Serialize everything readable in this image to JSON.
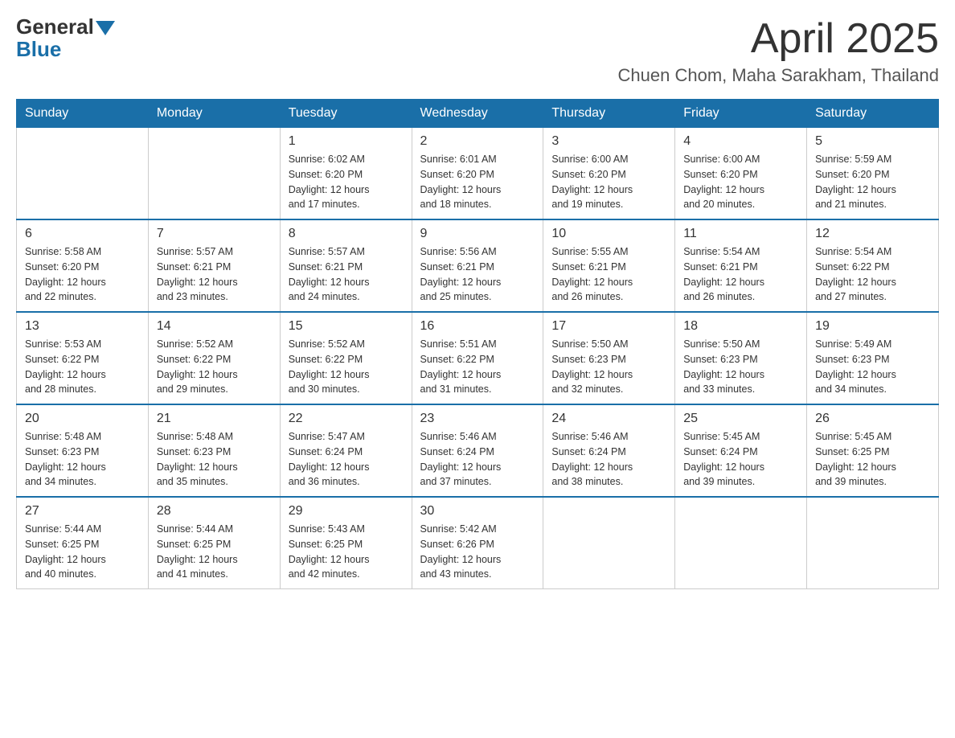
{
  "logo": {
    "general": "General",
    "blue": "Blue"
  },
  "header": {
    "month_year": "April 2025",
    "location": "Chuen Chom, Maha Sarakham, Thailand"
  },
  "weekdays": [
    "Sunday",
    "Monday",
    "Tuesday",
    "Wednesday",
    "Thursday",
    "Friday",
    "Saturday"
  ],
  "weeks": [
    [
      {
        "day": "",
        "info": ""
      },
      {
        "day": "",
        "info": ""
      },
      {
        "day": "1",
        "info": "Sunrise: 6:02 AM\nSunset: 6:20 PM\nDaylight: 12 hours\nand 17 minutes."
      },
      {
        "day": "2",
        "info": "Sunrise: 6:01 AM\nSunset: 6:20 PM\nDaylight: 12 hours\nand 18 minutes."
      },
      {
        "day": "3",
        "info": "Sunrise: 6:00 AM\nSunset: 6:20 PM\nDaylight: 12 hours\nand 19 minutes."
      },
      {
        "day": "4",
        "info": "Sunrise: 6:00 AM\nSunset: 6:20 PM\nDaylight: 12 hours\nand 20 minutes."
      },
      {
        "day": "5",
        "info": "Sunrise: 5:59 AM\nSunset: 6:20 PM\nDaylight: 12 hours\nand 21 minutes."
      }
    ],
    [
      {
        "day": "6",
        "info": "Sunrise: 5:58 AM\nSunset: 6:20 PM\nDaylight: 12 hours\nand 22 minutes."
      },
      {
        "day": "7",
        "info": "Sunrise: 5:57 AM\nSunset: 6:21 PM\nDaylight: 12 hours\nand 23 minutes."
      },
      {
        "day": "8",
        "info": "Sunrise: 5:57 AM\nSunset: 6:21 PM\nDaylight: 12 hours\nand 24 minutes."
      },
      {
        "day": "9",
        "info": "Sunrise: 5:56 AM\nSunset: 6:21 PM\nDaylight: 12 hours\nand 25 minutes."
      },
      {
        "day": "10",
        "info": "Sunrise: 5:55 AM\nSunset: 6:21 PM\nDaylight: 12 hours\nand 26 minutes."
      },
      {
        "day": "11",
        "info": "Sunrise: 5:54 AM\nSunset: 6:21 PM\nDaylight: 12 hours\nand 26 minutes."
      },
      {
        "day": "12",
        "info": "Sunrise: 5:54 AM\nSunset: 6:22 PM\nDaylight: 12 hours\nand 27 minutes."
      }
    ],
    [
      {
        "day": "13",
        "info": "Sunrise: 5:53 AM\nSunset: 6:22 PM\nDaylight: 12 hours\nand 28 minutes."
      },
      {
        "day": "14",
        "info": "Sunrise: 5:52 AM\nSunset: 6:22 PM\nDaylight: 12 hours\nand 29 minutes."
      },
      {
        "day": "15",
        "info": "Sunrise: 5:52 AM\nSunset: 6:22 PM\nDaylight: 12 hours\nand 30 minutes."
      },
      {
        "day": "16",
        "info": "Sunrise: 5:51 AM\nSunset: 6:22 PM\nDaylight: 12 hours\nand 31 minutes."
      },
      {
        "day": "17",
        "info": "Sunrise: 5:50 AM\nSunset: 6:23 PM\nDaylight: 12 hours\nand 32 minutes."
      },
      {
        "day": "18",
        "info": "Sunrise: 5:50 AM\nSunset: 6:23 PM\nDaylight: 12 hours\nand 33 minutes."
      },
      {
        "day": "19",
        "info": "Sunrise: 5:49 AM\nSunset: 6:23 PM\nDaylight: 12 hours\nand 34 minutes."
      }
    ],
    [
      {
        "day": "20",
        "info": "Sunrise: 5:48 AM\nSunset: 6:23 PM\nDaylight: 12 hours\nand 34 minutes."
      },
      {
        "day": "21",
        "info": "Sunrise: 5:48 AM\nSunset: 6:23 PM\nDaylight: 12 hours\nand 35 minutes."
      },
      {
        "day": "22",
        "info": "Sunrise: 5:47 AM\nSunset: 6:24 PM\nDaylight: 12 hours\nand 36 minutes."
      },
      {
        "day": "23",
        "info": "Sunrise: 5:46 AM\nSunset: 6:24 PM\nDaylight: 12 hours\nand 37 minutes."
      },
      {
        "day": "24",
        "info": "Sunrise: 5:46 AM\nSunset: 6:24 PM\nDaylight: 12 hours\nand 38 minutes."
      },
      {
        "day": "25",
        "info": "Sunrise: 5:45 AM\nSunset: 6:24 PM\nDaylight: 12 hours\nand 39 minutes."
      },
      {
        "day": "26",
        "info": "Sunrise: 5:45 AM\nSunset: 6:25 PM\nDaylight: 12 hours\nand 39 minutes."
      }
    ],
    [
      {
        "day": "27",
        "info": "Sunrise: 5:44 AM\nSunset: 6:25 PM\nDaylight: 12 hours\nand 40 minutes."
      },
      {
        "day": "28",
        "info": "Sunrise: 5:44 AM\nSunset: 6:25 PM\nDaylight: 12 hours\nand 41 minutes."
      },
      {
        "day": "29",
        "info": "Sunrise: 5:43 AM\nSunset: 6:25 PM\nDaylight: 12 hours\nand 42 minutes."
      },
      {
        "day": "30",
        "info": "Sunrise: 5:42 AM\nSunset: 6:26 PM\nDaylight: 12 hours\nand 43 minutes."
      },
      {
        "day": "",
        "info": ""
      },
      {
        "day": "",
        "info": ""
      },
      {
        "day": "",
        "info": ""
      }
    ]
  ]
}
